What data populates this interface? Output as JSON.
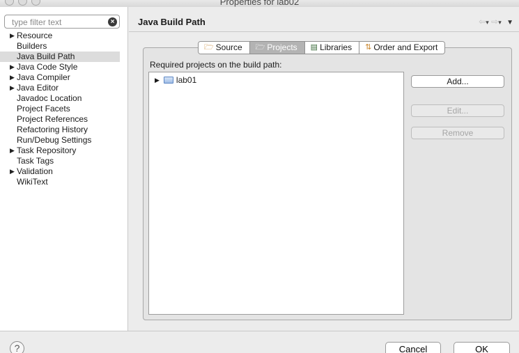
{
  "window": {
    "title": "Properties for lab02"
  },
  "filter": {
    "placeholder": "type filter text"
  },
  "tree": [
    {
      "label": "Resource",
      "expandable": true
    },
    {
      "label": "Builders",
      "expandable": false
    },
    {
      "label": "Java Build Path",
      "expandable": false,
      "selected": true
    },
    {
      "label": "Java Code Style",
      "expandable": true
    },
    {
      "label": "Java Compiler",
      "expandable": true
    },
    {
      "label": "Java Editor",
      "expandable": true
    },
    {
      "label": "Javadoc Location",
      "expandable": false
    },
    {
      "label": "Project Facets",
      "expandable": false
    },
    {
      "label": "Project References",
      "expandable": false
    },
    {
      "label": "Refactoring History",
      "expandable": false
    },
    {
      "label": "Run/Debug Settings",
      "expandable": false
    },
    {
      "label": "Task Repository",
      "expandable": true
    },
    {
      "label": "Task Tags",
      "expandable": false
    },
    {
      "label": "Validation",
      "expandable": true
    },
    {
      "label": "WikiText",
      "expandable": false
    }
  ],
  "page": {
    "title": "Java Build Path"
  },
  "tabs": [
    {
      "label": "Source",
      "icon": "source-folder-icon",
      "active": false
    },
    {
      "label": "Projects",
      "icon": "projects-folder-icon",
      "active": true
    },
    {
      "label": "Libraries",
      "icon": "libraries-icon",
      "active": false
    },
    {
      "label": "Order and Export",
      "icon": "order-export-icon",
      "active": false
    }
  ],
  "projects": {
    "label": "Required projects on the build path:",
    "items": [
      {
        "label": "lab01",
        "icon": "folder-icon"
      }
    ]
  },
  "buttons": {
    "add": "Add...",
    "edit": "Edit...",
    "remove": "Remove",
    "cancel": "Cancel",
    "ok": "OK"
  },
  "colors": {
    "selection": "#dcdcdc",
    "active_tab": "#b3b3b3"
  }
}
